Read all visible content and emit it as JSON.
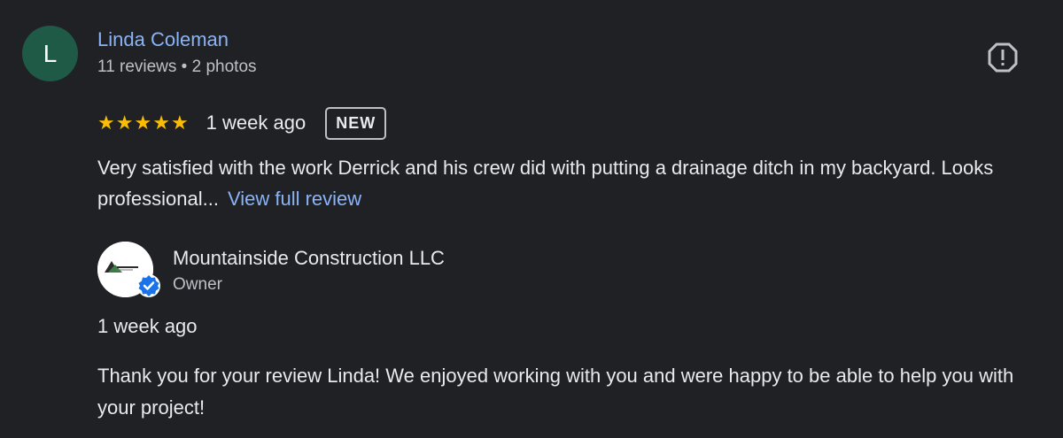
{
  "reviewer": {
    "initial": "L",
    "avatar_color": "#1e5a45",
    "name": "Linda Coleman",
    "meta": "11 reviews • 2 photos"
  },
  "report_icon": "report-octagon-icon",
  "review": {
    "rating": 5,
    "stars": [
      "★",
      "★",
      "★",
      "★",
      "★"
    ],
    "date": "1 week ago",
    "badge": "NEW",
    "text": "Very satisfied with the work Derrick and his crew did with putting a drainage ditch in my backyard. Looks professional...",
    "view_full_label": "View full review"
  },
  "owner_response": {
    "name": "Mountainside Construction LLC",
    "role": "Owner",
    "verified_icon": "verified-badge-icon",
    "date": "1 week ago",
    "text": "Thank you for your review Linda! We enjoyed working with you and were happy to be able to help you with your project!"
  },
  "colors": {
    "background": "#202124",
    "link": "#8ab4f8",
    "star": "#fbbc04",
    "verified": "#1a73e8"
  }
}
